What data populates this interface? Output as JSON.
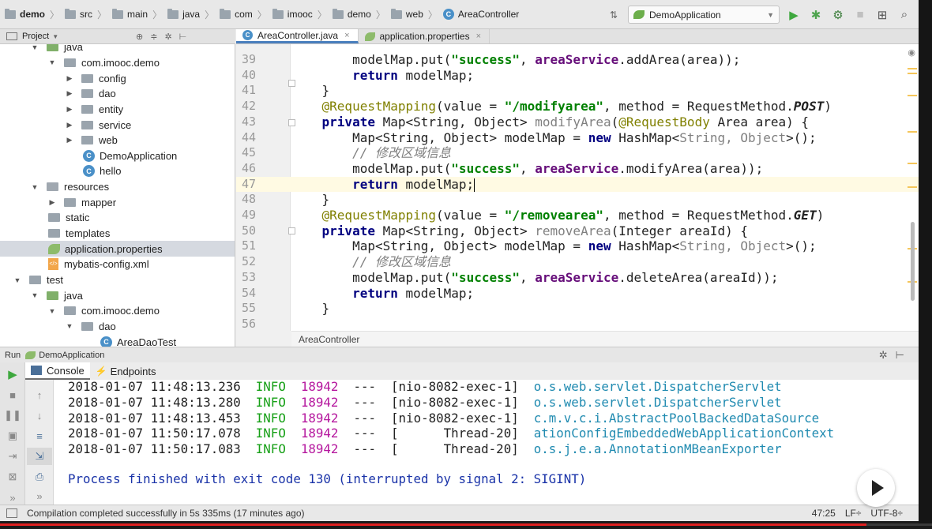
{
  "breadcrumbs": [
    {
      "label": "demo",
      "icon": "folder-icon",
      "bold": true
    },
    {
      "label": "src",
      "icon": "folder-icon"
    },
    {
      "label": "main",
      "icon": "folder-icon"
    },
    {
      "label": "java",
      "icon": "folder-icon"
    },
    {
      "label": "com",
      "icon": "folder-icon"
    },
    {
      "label": "imooc",
      "icon": "folder-icon"
    },
    {
      "label": "demo",
      "icon": "folder-icon"
    },
    {
      "label": "web",
      "icon": "folder-icon"
    },
    {
      "label": "AreaController",
      "icon": "class-icon"
    }
  ],
  "toolbar": {
    "run_config": "DemoApplication",
    "icons": [
      "sort-icon",
      "run-icon",
      "debug-icon",
      "coverage-icon",
      "stop-icon",
      "project-structure-icon",
      "search-icon"
    ]
  },
  "project_panel": {
    "title": "Project",
    "tree": [
      {
        "label": "java",
        "indent": 3,
        "type": "src",
        "twisty": "down"
      },
      {
        "label": "com.imooc.demo",
        "indent": 4,
        "type": "pkg",
        "twisty": "down"
      },
      {
        "label": "config",
        "indent": 5,
        "type": "pkg",
        "twisty": "right"
      },
      {
        "label": "dao",
        "indent": 5,
        "type": "pkg",
        "twisty": "right"
      },
      {
        "label": "entity",
        "indent": 5,
        "type": "pkg",
        "twisty": "right"
      },
      {
        "label": "service",
        "indent": 5,
        "type": "pkg",
        "twisty": "right"
      },
      {
        "label": "web",
        "indent": 5,
        "type": "pkg",
        "twisty": "right"
      },
      {
        "label": "DemoApplication",
        "indent": 6,
        "type": "class"
      },
      {
        "label": "hello",
        "indent": 6,
        "type": "class"
      },
      {
        "label": "resources",
        "indent": 3,
        "type": "res",
        "twisty": "down"
      },
      {
        "label": "mapper",
        "indent": 4,
        "type": "pkg",
        "twisty": "right"
      },
      {
        "label": "static",
        "indent": 4,
        "type": "pkg"
      },
      {
        "label": "templates",
        "indent": 4,
        "type": "pkg"
      },
      {
        "label": "application.properties",
        "indent": 4,
        "type": "prop",
        "selected": true
      },
      {
        "label": "mybatis-config.xml",
        "indent": 4,
        "type": "xml"
      },
      {
        "label": "test",
        "indent": 2,
        "type": "pkg",
        "twisty": "down"
      },
      {
        "label": "java",
        "indent": 3,
        "type": "src",
        "twisty": "down"
      },
      {
        "label": "com.imooc.demo",
        "indent": 4,
        "type": "pkg",
        "twisty": "down"
      },
      {
        "label": "dao",
        "indent": 5,
        "type": "pkg",
        "twisty": "down"
      },
      {
        "label": "AreaDaoTest",
        "indent": 7,
        "type": "class"
      }
    ]
  },
  "editor": {
    "tabs": [
      {
        "label": "AreaController.java",
        "active": true,
        "icon": "class-icon"
      },
      {
        "label": "application.properties",
        "active": false,
        "icon": "properties-icon"
      }
    ],
    "footer_breadcrumb": "AreaController",
    "current_line": "47",
    "lines": [
      {
        "n": "39",
        "parts": [
          [
            "",
            "        modelMap.put("
          ],
          [
            "str",
            "\"success\""
          ],
          [
            "",
            ", "
          ],
          [
            "fld",
            "areaService"
          ],
          [
            "",
            ".addArea(area));"
          ]
        ]
      },
      {
        "n": "40",
        "parts": [
          [
            "",
            "        "
          ],
          [
            "kw",
            "return"
          ],
          [
            "",
            " modelMap;"
          ]
        ]
      },
      {
        "n": "41",
        "parts": [
          [
            "",
            "    }"
          ]
        ]
      },
      {
        "n": "42",
        "parts": [
          [
            "ann",
            "    @RequestMapping"
          ],
          [
            "",
            "(value = "
          ],
          [
            "str",
            "\"/modifyarea\""
          ],
          [
            "",
            ", method = RequestMethod."
          ],
          [
            "ital",
            "POST"
          ],
          [
            "",
            ")"
          ]
        ]
      },
      {
        "n": "43",
        "parts": [
          [
            "",
            "    "
          ],
          [
            "kw",
            "private"
          ],
          [
            "",
            " Map<String, Object> "
          ],
          [
            "unused",
            "modifyArea"
          ],
          [
            "",
            "("
          ],
          [
            "ann",
            "@RequestBody"
          ],
          [
            "",
            " Area area) {"
          ]
        ]
      },
      {
        "n": "44",
        "parts": [
          [
            "",
            "        Map<String, Object> modelMap = "
          ],
          [
            "kw",
            "new"
          ],
          [
            "",
            " HashMap<"
          ],
          [
            "gen",
            "String, Object"
          ],
          [
            "",
            ">();"
          ]
        ]
      },
      {
        "n": "45",
        "parts": [
          [
            "cmt",
            "        // 修改区域信息"
          ]
        ]
      },
      {
        "n": "46",
        "parts": [
          [
            "",
            "        modelMap.put("
          ],
          [
            "str",
            "\"success\""
          ],
          [
            "",
            ", "
          ],
          [
            "fld",
            "areaService"
          ],
          [
            "",
            ".modifyArea(area));"
          ]
        ]
      },
      {
        "n": "47",
        "parts": [
          [
            "",
            "        "
          ],
          [
            "kw",
            "return"
          ],
          [
            "",
            " modelMap;"
          ]
        ]
      },
      {
        "n": "48",
        "parts": [
          [
            "",
            "    }"
          ]
        ]
      },
      {
        "n": "49",
        "parts": [
          [
            "ann",
            "    @RequestMapping"
          ],
          [
            "",
            "(value = "
          ],
          [
            "str",
            "\"/removearea\""
          ],
          [
            "",
            ", method = RequestMethod."
          ],
          [
            "ital",
            "GET"
          ],
          [
            "",
            ")"
          ]
        ]
      },
      {
        "n": "50",
        "parts": [
          [
            "",
            "    "
          ],
          [
            "kw",
            "private"
          ],
          [
            "",
            " Map<String, Object> "
          ],
          [
            "unused",
            "removeArea"
          ],
          [
            "",
            "(Integer areaId) {"
          ]
        ]
      },
      {
        "n": "51",
        "parts": [
          [
            "",
            "        Map<String, Object> modelMap = "
          ],
          [
            "kw",
            "new"
          ],
          [
            "",
            " HashMap<"
          ],
          [
            "gen",
            "String, Object"
          ],
          [
            "",
            ">();"
          ]
        ]
      },
      {
        "n": "52",
        "parts": [
          [
            "cmt",
            "        // 修改区域信息"
          ]
        ]
      },
      {
        "n": "53",
        "parts": [
          [
            "",
            "        modelMap.put("
          ],
          [
            "str",
            "\"success\""
          ],
          [
            "",
            ", "
          ],
          [
            "fld",
            "areaService"
          ],
          [
            "",
            ".deleteArea(areaId));"
          ]
        ]
      },
      {
        "n": "54",
        "parts": [
          [
            "",
            "        "
          ],
          [
            "kw",
            "return"
          ],
          [
            "",
            " modelMap;"
          ]
        ]
      },
      {
        "n": "55",
        "parts": [
          [
            "",
            "    }"
          ]
        ]
      },
      {
        "n": "56",
        "parts": []
      }
    ]
  },
  "run_panel": {
    "label": "Run",
    "config": "DemoApplication",
    "tabs": [
      "Console",
      "Endpoints"
    ],
    "log": [
      {
        "ts": "2018-01-07 11:48:13.236",
        "level": "INFO",
        "pid": "18942",
        "sep": "---",
        "thread": "[nio-8082-exec-1]",
        "logger": "o.s.web.servlet.DispatcherServlet"
      },
      {
        "ts": "2018-01-07 11:48:13.280",
        "level": "INFO",
        "pid": "18942",
        "sep": "---",
        "thread": "[nio-8082-exec-1]",
        "logger": "o.s.web.servlet.DispatcherServlet"
      },
      {
        "ts": "2018-01-07 11:48:13.453",
        "level": "INFO",
        "pid": "18942",
        "sep": "---",
        "thread": "[nio-8082-exec-1]",
        "logger": "c.m.v.c.i.AbstractPoolBackedDataSource"
      },
      {
        "ts": "2018-01-07 11:50:17.078",
        "level": "INFO",
        "pid": "18942",
        "sep": "---",
        "thread": "[      Thread-20]",
        "logger": "ationConfigEmbeddedWebApplicationContext"
      },
      {
        "ts": "2018-01-07 11:50:17.083",
        "level": "INFO",
        "pid": "18942",
        "sep": "---",
        "thread": "[      Thread-20]",
        "logger": "o.s.j.e.a.AnnotationMBeanExporter"
      }
    ],
    "exit_message": "Process finished with exit code 130 (interrupted by signal 2: SIGINT)"
  },
  "status_bar": {
    "message": "Compilation completed successfully in 5s 335ms (17 minutes ago)",
    "position": "47:25",
    "line_sep": "LF÷",
    "encoding": "UTF-8÷"
  },
  "video": {
    "progress": 0.93
  }
}
